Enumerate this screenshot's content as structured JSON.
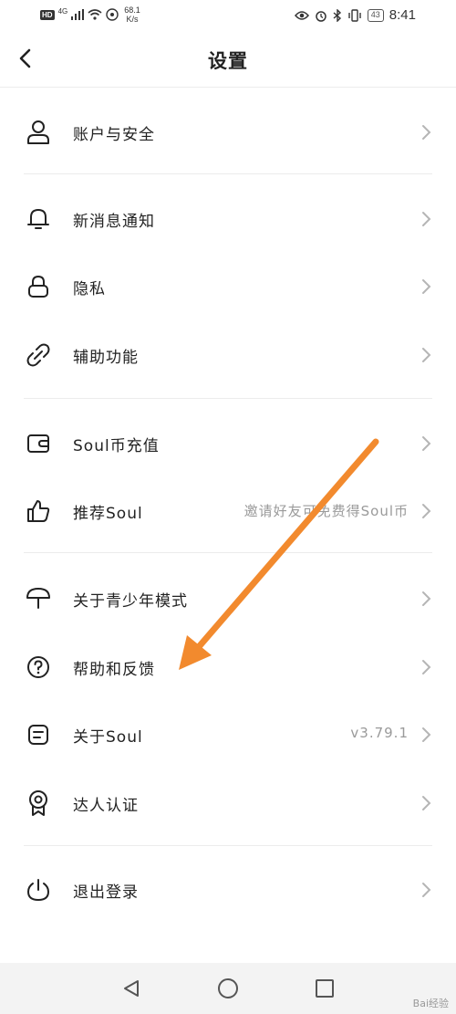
{
  "status_bar": {
    "hd": "HD",
    "network_type": "4G",
    "speed_value": "68.1",
    "speed_unit": "K/s",
    "battery": "43",
    "time": "8:41"
  },
  "header": {
    "title": "设置"
  },
  "menu": [
    {
      "label": "账户与安全",
      "value": ""
    },
    {
      "label": "新消息通知",
      "value": ""
    },
    {
      "label": "隐私",
      "value": ""
    },
    {
      "label": "辅助功能",
      "value": ""
    },
    {
      "label": "Soul币充值",
      "value": ""
    },
    {
      "label": "推荐Soul",
      "value": "邀请好友可免费得Soul币"
    },
    {
      "label": "关于青少年模式",
      "value": ""
    },
    {
      "label": "帮助和反馈",
      "value": ""
    },
    {
      "label": "关于Soul",
      "value": "v3.79.1"
    },
    {
      "label": "达人认证",
      "value": ""
    },
    {
      "label": "退出登录",
      "value": ""
    }
  ],
  "icons": [
    "user-icon",
    "bell-icon",
    "lock-icon",
    "link-icon",
    "wallet-icon",
    "thumbs-up-icon",
    "umbrella-icon",
    "question-icon",
    "document-icon",
    "badge-icon",
    "power-icon"
  ],
  "watermark": "Bai经验",
  "colors": {
    "annotation_arrow": "#f28a2e",
    "text": "#222222",
    "secondary_text": "#9a9a9a",
    "divider": "#ececec",
    "nav_bar_bg": "#f3f3f3"
  }
}
